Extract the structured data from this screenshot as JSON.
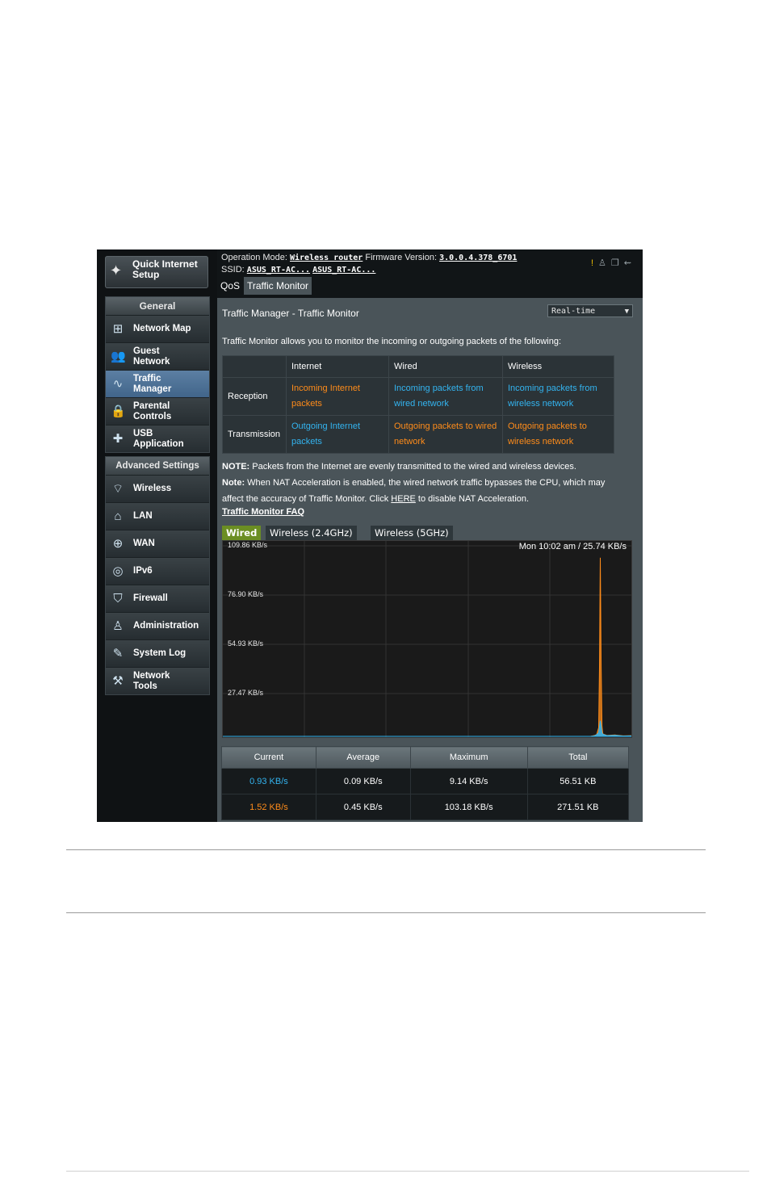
{
  "colors": {
    "incoming": "#33b4f0",
    "outgoing": "#ff8c1a",
    "active_tab": "#6b8e23",
    "active_nav": "#4f7297"
  },
  "sidebar": {
    "quick_setup": {
      "label": "Quick Internet Setup",
      "icon": "magic-wand-icon"
    },
    "general": {
      "title": "General",
      "items": [
        {
          "label": "Network Map",
          "icon": "network-map-icon"
        },
        {
          "label": "Guest Network",
          "icon": "guest-users-icon"
        },
        {
          "label": "Traffic Manager",
          "icon": "traffic-chart-icon",
          "active": true
        },
        {
          "label": "Parental Controls",
          "icon": "lock-icon"
        },
        {
          "label": "USB Application",
          "icon": "puzzle-icon"
        }
      ]
    },
    "advanced": {
      "title": "Advanced Settings",
      "items": [
        {
          "label": "Wireless",
          "icon": "wifi-icon"
        },
        {
          "label": "LAN",
          "icon": "home-icon"
        },
        {
          "label": "WAN",
          "icon": "globe-icon"
        },
        {
          "label": "IPv6",
          "icon": "ipv6-icon"
        },
        {
          "label": "Firewall",
          "icon": "shield-icon"
        },
        {
          "label": "Administration",
          "icon": "admin-user-icon"
        },
        {
          "label": "System Log",
          "icon": "log-edit-icon"
        },
        {
          "label": "Network Tools",
          "icon": "tools-icon"
        }
      ]
    }
  },
  "header": {
    "op_mode_label": "Operation Mode:",
    "op_mode_value": "Wireless router",
    "firmware_label": "Firmware Version:",
    "firmware_value": "3.0.0.4.378_6701",
    "ssid_label": "SSID:",
    "ssid_1": "ASUS_RT-AC...",
    "ssid_2": "ASUS_RT-AC...",
    "status_icons": [
      "warning-icon",
      "users-icon",
      "copy-icon",
      "usb-icon"
    ],
    "tabs": [
      {
        "label": "QoS"
      },
      {
        "label": "Traffic Monitor",
        "selected": true
      }
    ]
  },
  "page": {
    "title": "Traffic Manager - Traffic Monitor",
    "mode_select": "Real-time",
    "description": "Traffic Monitor allows you to monitor the incoming or outgoing packets of the following:",
    "matrix": {
      "columns": [
        "Internet",
        "Wired",
        "Wireless"
      ],
      "rows": [
        {
          "label": "Reception",
          "cells": [
            "Incoming Internet packets",
            "Incoming packets from wired network",
            "Incoming packets from wireless network"
          ]
        },
        {
          "label": "Transmission",
          "cells": [
            "Outgoing Internet packets",
            "Outgoing packets to wired network",
            "Outgoing packets to wireless network"
          ]
        }
      ]
    },
    "note1_label": "NOTE:",
    "note1": " Packets from the Internet are evenly transmitted to the wired and wireless devices.",
    "note2_label": "Note:",
    "note2_a": " When NAT Acceleration is enabled, the wired network traffic bypasses the CPU, which may affect the accuracy of Traffic Monitor. Click ",
    "note2_link": "HERE",
    "note2_b": " to disable NAT Acceleration.",
    "faq_link": "Traffic Monitor FAQ",
    "chart_tabs": [
      {
        "label": "Wired",
        "selected": true
      },
      {
        "label": "Wireless (2.4GHz)"
      },
      {
        "label": "Wireless (5GHz)"
      }
    ],
    "chart_readout": "Mon 10:02 am / 25.74 KB/s",
    "stats": {
      "headers": [
        "Current",
        "Average",
        "Maximum",
        "Total"
      ],
      "rows": [
        {
          "current": "0.93 KB/s",
          "average": "0.09 KB/s",
          "maximum": "9.14 KB/s",
          "total": "56.51 KB"
        },
        {
          "current": "1.52 KB/s",
          "average": "0.45 KB/s",
          "maximum": "103.18 KB/s",
          "total": "271.51 KB"
        }
      ]
    }
  },
  "chart_data": {
    "type": "area",
    "title": "",
    "y_ticks": [
      "109.86 KB/s",
      "76.90 KB/s",
      "54.93 KB/s",
      "27.47 KB/s"
    ],
    "ylim": [
      0,
      109.86
    ],
    "x_range": [
      0,
      100
    ],
    "grid": true,
    "series": [
      {
        "color": "#ff8c1a",
        "points": [
          [
            0,
            0
          ],
          [
            90,
            0
          ],
          [
            91,
            0.5
          ],
          [
            91.5,
            1
          ],
          [
            92,
            5
          ],
          [
            92.2,
            40
          ],
          [
            92.4,
            103
          ],
          [
            92.6,
            40
          ],
          [
            92.8,
            6
          ],
          [
            93,
            1.5
          ],
          [
            93.5,
            1
          ],
          [
            94,
            0.5
          ],
          [
            96,
            0.8
          ],
          [
            98,
            0.3
          ],
          [
            100,
            0.4
          ]
        ]
      },
      {
        "color": "#33b4f0",
        "points": [
          [
            0,
            0
          ],
          [
            90,
            0
          ],
          [
            91,
            0.3
          ],
          [
            91.5,
            1
          ],
          [
            92,
            2
          ],
          [
            92.4,
            9
          ],
          [
            92.8,
            2
          ],
          [
            93,
            1.2
          ],
          [
            94,
            0.4
          ],
          [
            96,
            0.6
          ],
          [
            98,
            0.2
          ],
          [
            100,
            0.3
          ]
        ]
      }
    ]
  }
}
